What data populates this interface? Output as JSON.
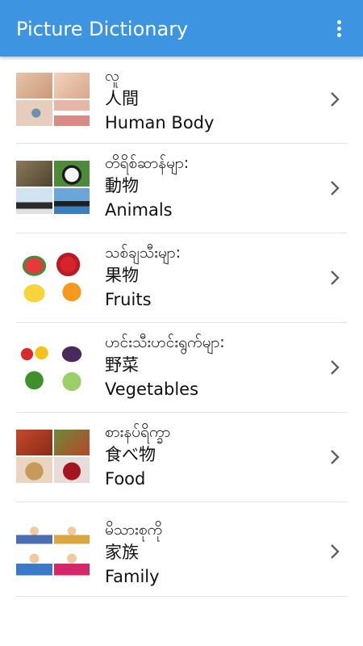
{
  "appbar": {
    "title": "Picture Dictionary",
    "menu_icon": "more-vert-icon"
  },
  "colors": {
    "appbar": "#3d95e2",
    "divider": "#e2e2e2",
    "chevron": "#606060"
  },
  "categories": [
    {
      "burmese": "လူ",
      "chinese": "人間",
      "english": "Human Body",
      "icon": "human-body-thumbnail"
    },
    {
      "burmese": "တိရိစ်ဆာန်မျာ:",
      "chinese": "動物",
      "english": "Animals",
      "icon": "animals-thumbnail"
    },
    {
      "burmese": "သစ်ချသီးမျာ:",
      "chinese": "果物",
      "english": "Fruits",
      "icon": "fruits-thumbnail"
    },
    {
      "burmese": "ဟင်းသီးဟင်းရွက်မျာ:",
      "chinese": "野菜",
      "english": "Vegetables",
      "icon": "vegetables-thumbnail"
    },
    {
      "burmese": "စားနပ်ရိက္ခာ",
      "chinese": "食べ物",
      "english": "Food",
      "icon": "food-thumbnail"
    },
    {
      "burmese": "မိသားစုကို",
      "chinese": "家族",
      "english": "Family",
      "icon": "family-thumbnail"
    }
  ]
}
